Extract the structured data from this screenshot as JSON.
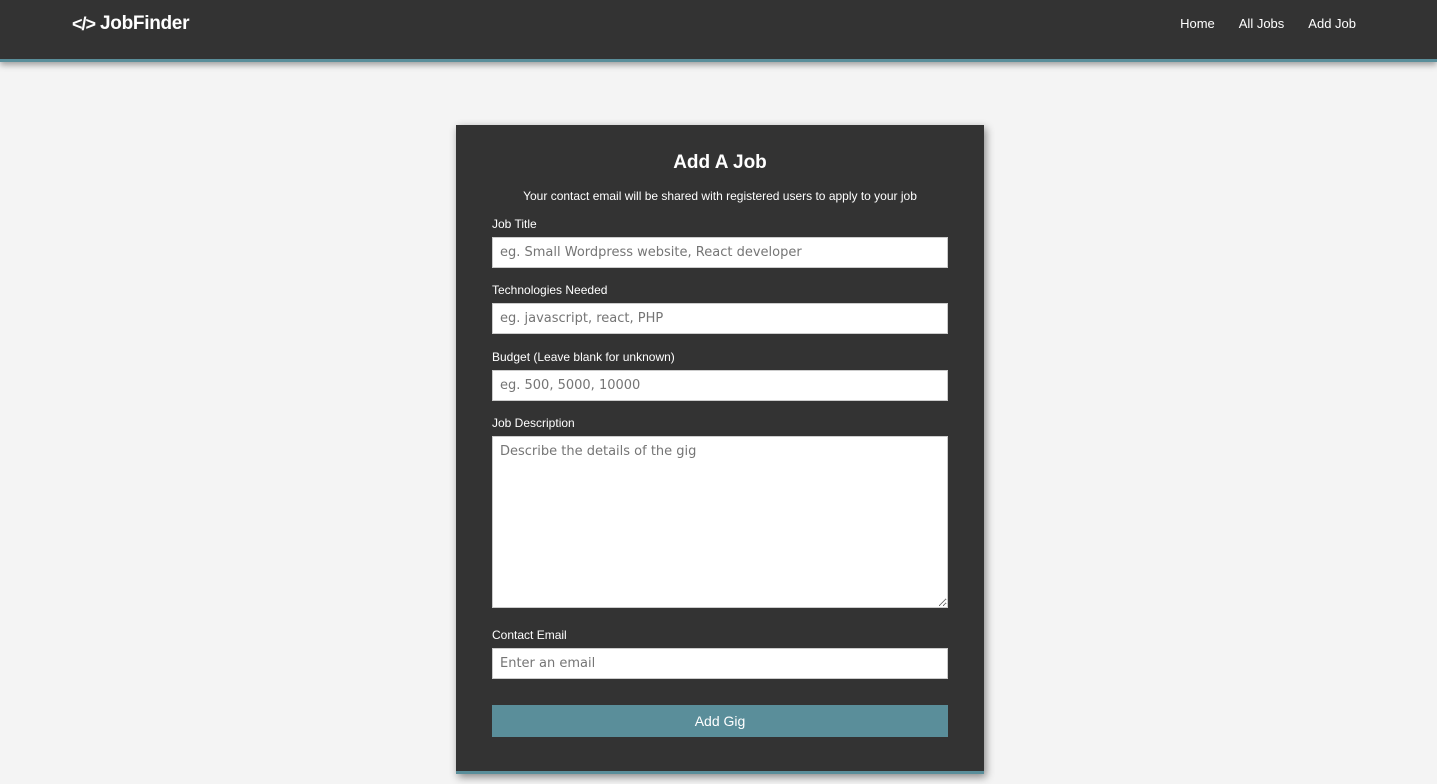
{
  "navbar": {
    "brand_icon": "</>",
    "brand_name": "JobFinder",
    "links": [
      {
        "label": "Home"
      },
      {
        "label": "All Jobs"
      },
      {
        "label": "Add Job"
      }
    ]
  },
  "form": {
    "title": "Add A Job",
    "subtitle": "Your contact email will be shared with registered users to apply to your job",
    "fields": {
      "job_title": {
        "label": "Job Title",
        "placeholder": "eg. Small Wordpress website, React developer",
        "value": ""
      },
      "technologies": {
        "label": "Technologies Needed",
        "placeholder": "eg. javascript, react, PHP",
        "value": ""
      },
      "budget": {
        "label": "Budget (Leave blank for unknown)",
        "placeholder": "eg. 500, 5000, 10000",
        "value": ""
      },
      "description": {
        "label": "Job Description",
        "placeholder": "Describe the details of the gig",
        "value": ""
      },
      "contact_email": {
        "label": "Contact Email",
        "placeholder": "Enter an email",
        "value": ""
      }
    },
    "submit_label": "Add Gig"
  },
  "colors": {
    "navbar_bg": "#333333",
    "accent": "#5a8e9a",
    "page_bg": "#f4f4f4"
  }
}
